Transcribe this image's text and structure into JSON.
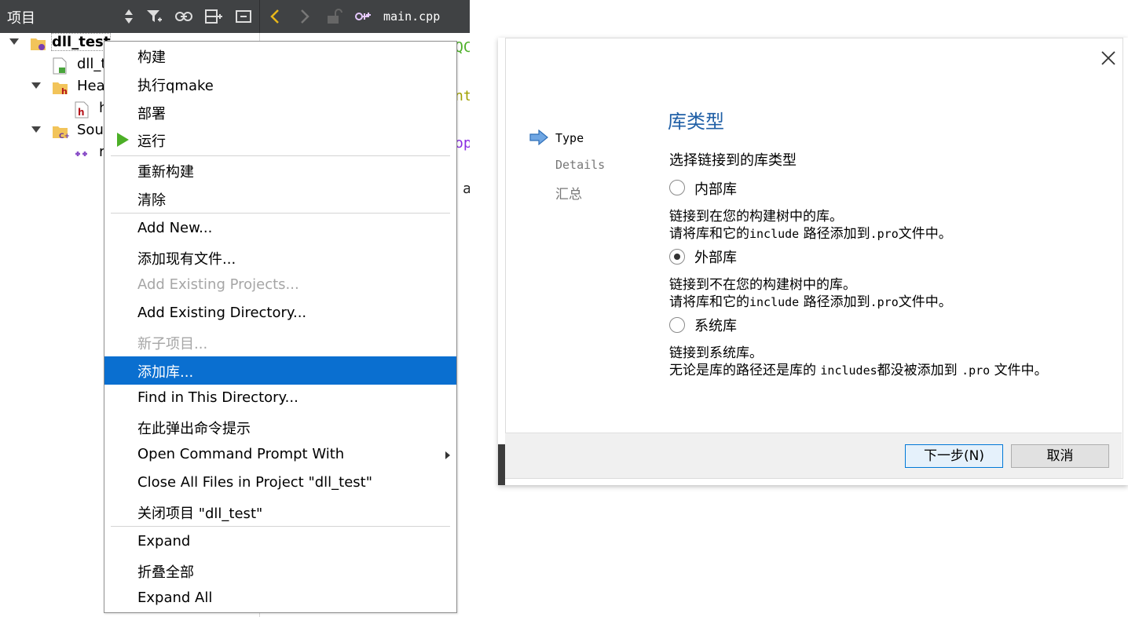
{
  "project_pane": {
    "title": "项目",
    "toolbar_icons": [
      "sort-updown-icon",
      "filter-icon",
      "link-icon",
      "split-add-icon",
      "close-pane-icon"
    ]
  },
  "editor_toolbar": {
    "back_icon": "chevron-left-icon",
    "forward_icon": "chevron-right-icon",
    "lock_icon": "lock-icon",
    "file_icon": "cpp-file-icon",
    "filename": "main.cpp"
  },
  "tree": {
    "project": "dll_test",
    "items": [
      {
        "label": "dll_t",
        "icon": "pro-file-icon"
      },
      {
        "label": "Hea",
        "icon": "headers-folder-icon"
      },
      {
        "label": "h",
        "icon": "header-file-icon"
      },
      {
        "label": "Sou",
        "icon": "sources-folder-icon"
      },
      {
        "label": "r",
        "icon": "cpp-file-icon"
      }
    ]
  },
  "editor_fragments": [
    "QC",
    "nt",
    "op",
    "a"
  ],
  "context_menu": {
    "items": [
      {
        "label": "构建",
        "disabled": false
      },
      {
        "label": "执行qmake",
        "disabled": false
      },
      {
        "label": "部署",
        "disabled": false
      },
      {
        "label": "运行",
        "disabled": false,
        "icon": "run-icon"
      },
      {
        "label": "重新构建",
        "disabled": false
      },
      {
        "label": "清除",
        "disabled": false
      },
      {
        "label": "Add New...",
        "disabled": false
      },
      {
        "label": "添加现有文件...",
        "disabled": false
      },
      {
        "label": "Add Existing Projects...",
        "disabled": true
      },
      {
        "label": "Add Existing Directory...",
        "disabled": false
      },
      {
        "label": "新子项目...",
        "disabled": true
      },
      {
        "label": "添加库...",
        "disabled": false,
        "highlighted": true
      },
      {
        "label": "Find in This Directory...",
        "disabled": false
      },
      {
        "label": "在此弹出命令提示",
        "disabled": false
      },
      {
        "label": "Open Command Prompt With",
        "disabled": false,
        "submenu": true
      },
      {
        "label": "Close All Files in Project \"dll_test\"",
        "disabled": false
      },
      {
        "label": "关闭项目 \"dll_test\"",
        "disabled": false
      },
      {
        "label": "Expand",
        "disabled": false
      },
      {
        "label": "折叠全部",
        "disabled": false
      },
      {
        "label": "Expand All",
        "disabled": false
      }
    ]
  },
  "wizard": {
    "steps": [
      {
        "label": "Type",
        "current": true
      },
      {
        "label": "Details",
        "current": false
      },
      {
        "label": "汇总",
        "current": false
      }
    ],
    "title": "库类型",
    "prompt": "选择链接到的库类型",
    "options": [
      {
        "label": "内部库",
        "selected": false,
        "line1": "链接到在您的构建树中的库。",
        "line2_a": "请将库和它的",
        "line2_code1": "include",
        "line2_b": " 路径添加到",
        "line2_code2": ".pro",
        "line2_c": "文件中。"
      },
      {
        "label": "外部库",
        "selected": true,
        "line1": "链接到不在您的构建树中的库。",
        "line2_a": "请将库和它的",
        "line2_code1": "include",
        "line2_b": " 路径添加到",
        "line2_code2": ".pro",
        "line2_c": "文件中。"
      },
      {
        "label": "系统库",
        "selected": false,
        "line1": "链接到系统库。",
        "line2_a": "无论是库的路径还是库的 ",
        "line2_code1": "includes",
        "line2_b": "都没被添加到 ",
        "line2_code2": ".pro",
        "line2_c": " 文件中。"
      }
    ],
    "buttons": {
      "next": "下一步(N)",
      "cancel": "取消"
    }
  },
  "colors": {
    "toolbar": "#404244",
    "highlight": "#0a6fd0",
    "wizard_title": "#1f5fa6",
    "run_green": "#4caf27"
  }
}
